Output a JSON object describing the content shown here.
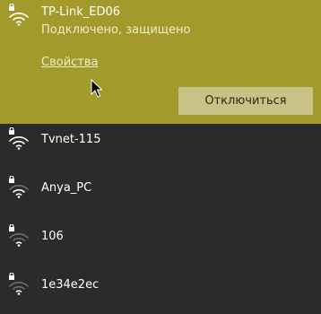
{
  "connected_network": {
    "ssid": "TP-Link_ED06",
    "status": "Подключено, защищено",
    "properties_link": "Свойства",
    "disconnect_label": "Отключиться"
  },
  "networks": [
    {
      "ssid": "Tvnet-115",
      "secured": true
    },
    {
      "ssid": "Anya_PC",
      "secured": true
    },
    {
      "ssid": "106",
      "secured": true
    },
    {
      "ssid": "1e34e2ec",
      "secured": true
    }
  ],
  "colors": {
    "connected_bg": "#a39a2c",
    "button_bg": "#c9c286",
    "panel_bg": "#2b2b2b"
  }
}
